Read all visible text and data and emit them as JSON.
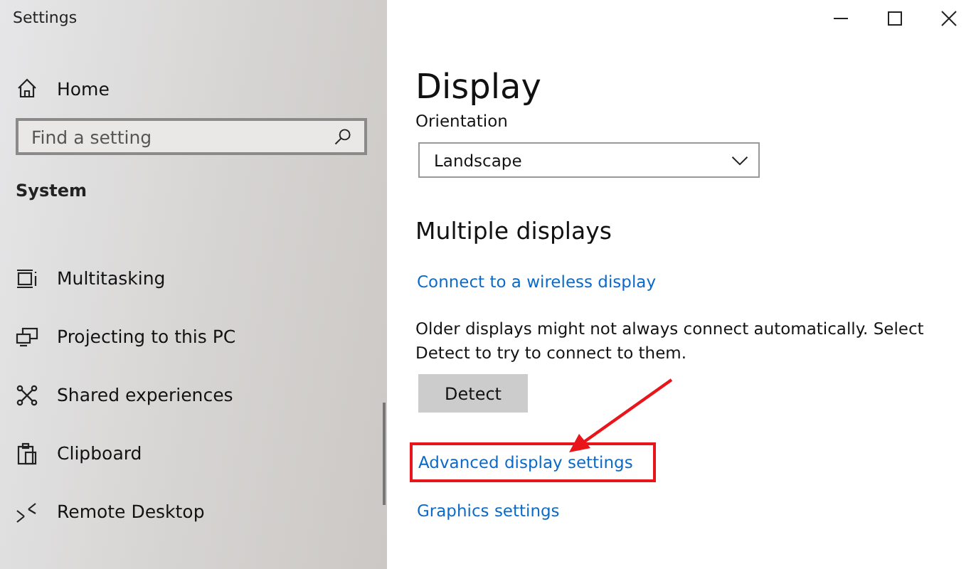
{
  "window": {
    "title": "Settings"
  },
  "sidebar": {
    "home": "Home",
    "search": {
      "placeholder": "Find a setting"
    },
    "section": "System",
    "items": [
      {
        "label": "Multitasking",
        "kind": "multitask"
      },
      {
        "label": "Projecting to this PC",
        "kind": "project"
      },
      {
        "label": "Shared experiences",
        "kind": "shared"
      },
      {
        "label": "Clipboard",
        "kind": "clipboard"
      },
      {
        "label": "Remote Desktop",
        "kind": "remote"
      }
    ]
  },
  "page": {
    "title": "Display",
    "orientation": {
      "label": "Orientation",
      "value": "Landscape"
    },
    "section": "Multiple displays",
    "wireless_link": "Connect to a wireless display",
    "description": "Older displays might not always connect automatically. Select Detect to try to connect to them.",
    "detect_button": "Detect",
    "links": [
      {
        "label": "Advanced display settings",
        "highlighted": true
      },
      {
        "label": "Graphics settings",
        "highlighted": false
      }
    ]
  }
}
